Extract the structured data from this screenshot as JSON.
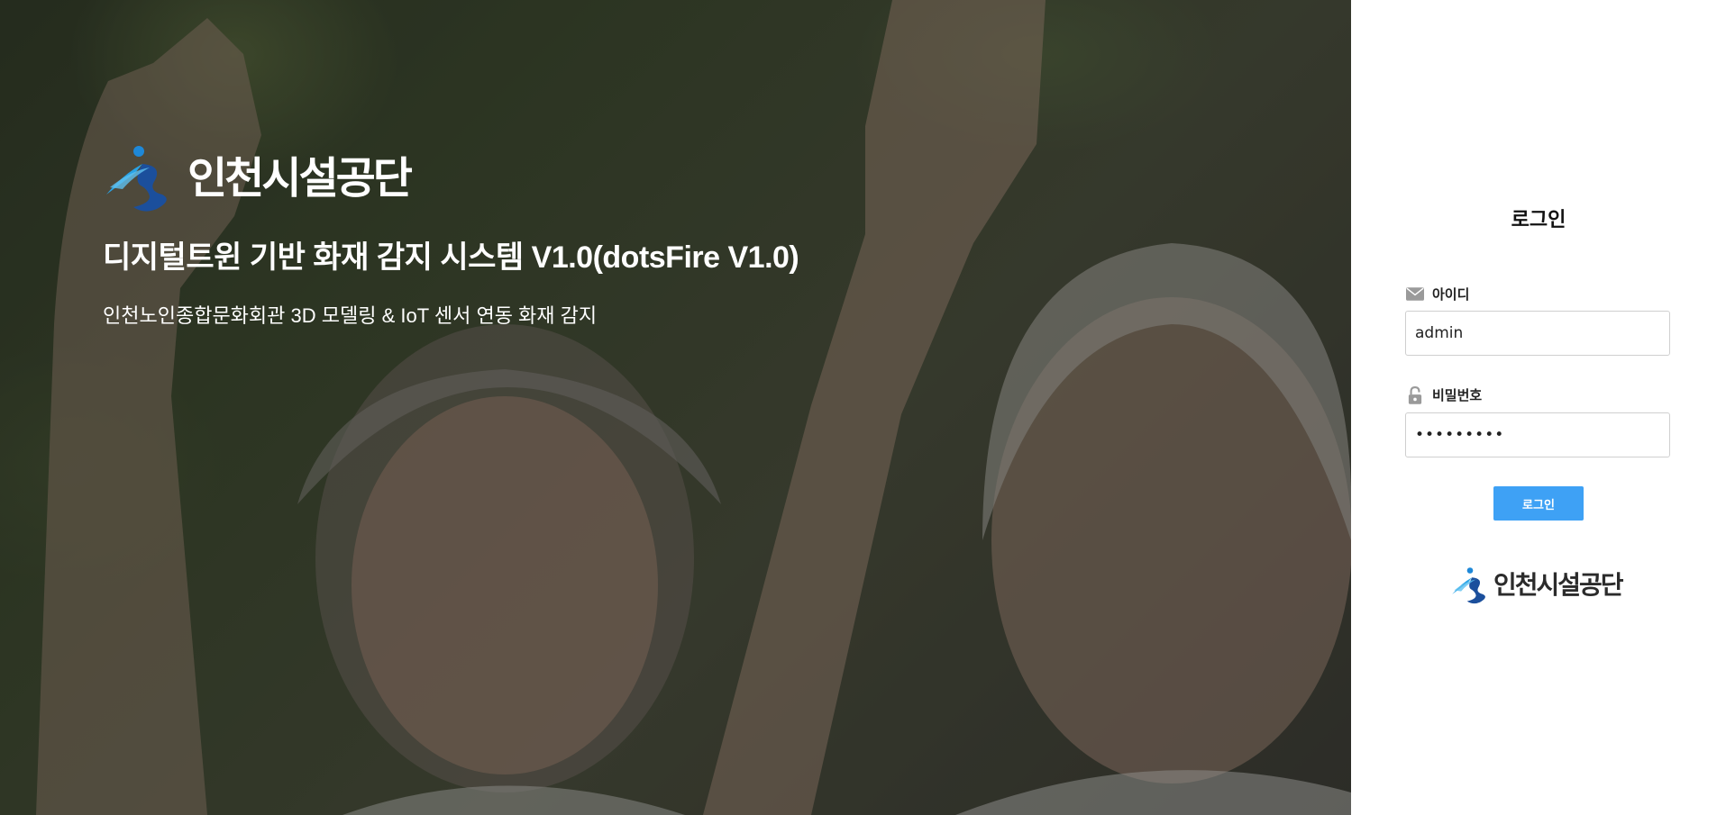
{
  "hero": {
    "logo_text": "인천시설공단",
    "title": "디지털트윈 기반 화재 감지 시스템 V1.0(dotsFire V1.0)",
    "subtitle": "인천노인종합문화회관 3D 모델링 & IoT 센서 연동 화재 감지"
  },
  "login": {
    "title": "로그인",
    "id_label": "아이디",
    "id_value": "admin",
    "password_label": "비밀번호",
    "password_value": "•••••••••",
    "button_label": "로그인",
    "logo_text": "인천시설공단"
  },
  "icons": {
    "id_icon": "envelope-icon",
    "password_icon": "unlock-icon",
    "logo_mark": "runner-logo-icon"
  },
  "colors": {
    "button_bg": "#3ea1f5",
    "logo_blue": "#1e88d8",
    "logo_dark": "#1b4f9c"
  }
}
